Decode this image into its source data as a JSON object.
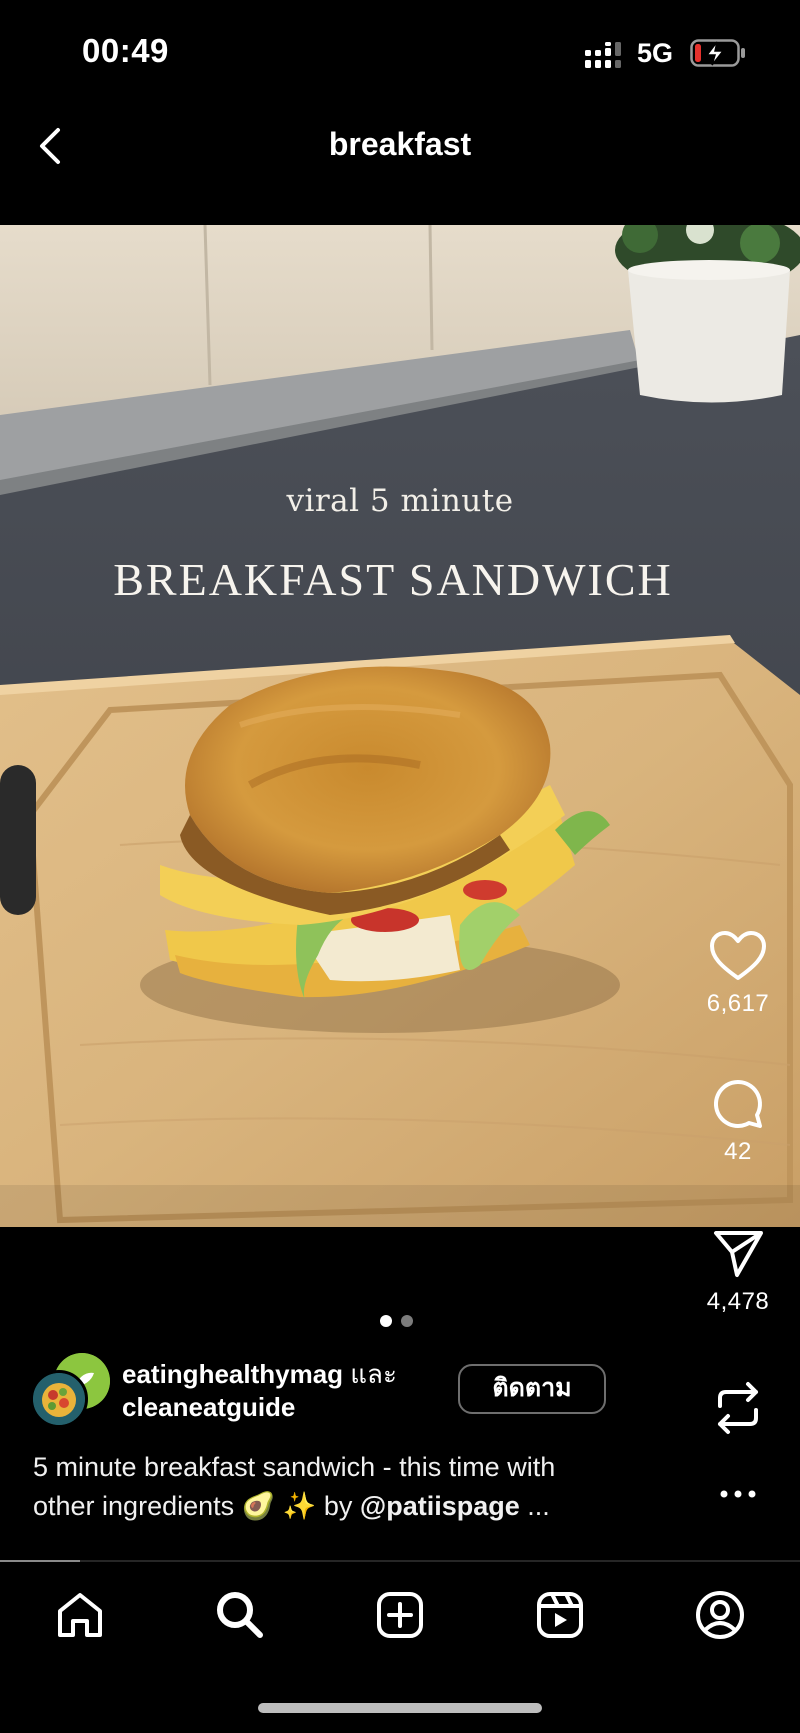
{
  "status_bar": {
    "time": "00:49",
    "network": "5G",
    "battery_state": "charging-low"
  },
  "header": {
    "title": "breakfast"
  },
  "media": {
    "overlay_subtitle": "viral 5 minute",
    "overlay_title": "BREAKFAST SANDWICH",
    "carousel_page": 1,
    "carousel_total": 2
  },
  "actions": {
    "likes": "6,617",
    "comments": "42",
    "shares": "4,478"
  },
  "post": {
    "author_primary": "eatinghealthymag",
    "author_conjunction": "และ",
    "author_secondary": "cleaneatguide",
    "follow_label": "ติดตาม",
    "caption_line1": "5 minute breakfast sandwich - this time with",
    "caption_line2_prefix": "other ingredients 🥑 ✨ by",
    "caption_mention": "@patiispage",
    "caption_more": "..."
  },
  "video_progress": 0.1,
  "tabs": [
    "home-icon",
    "search-icon",
    "create-icon",
    "reels-icon",
    "profile-icon"
  ],
  "colors": {
    "background": "#000000",
    "text": "#ffffff",
    "battery_low": "#e5322d",
    "inactive_dot": "#7c7c7c"
  }
}
